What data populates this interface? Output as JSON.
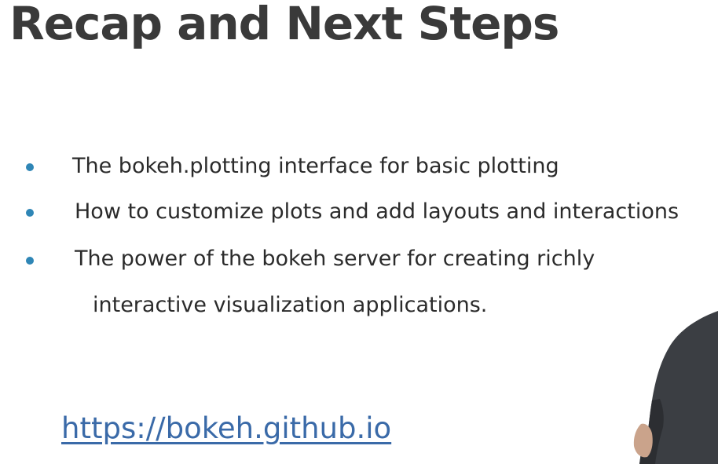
{
  "slide": {
    "title": "Recap and Next Steps",
    "bullets": [
      {
        "text": "The bokeh.plotting interface for basic plotting"
      },
      {
        "text": "How to customize plots and add layouts and interactions"
      },
      {
        "text": "The power of the bokeh server for creating richly"
      }
    ],
    "bullet_continuation": "interactive visualization applications.",
    "link": "https://bokeh.github.io"
  },
  "colors": {
    "title": "#3a3a3a",
    "bullet_dot": "#2f86b6",
    "body_text": "#2b2b2b",
    "link": "#3a6aa8",
    "presenter_shirt": "#3b3e43"
  },
  "icons": {
    "bullet": "filled-circle"
  }
}
